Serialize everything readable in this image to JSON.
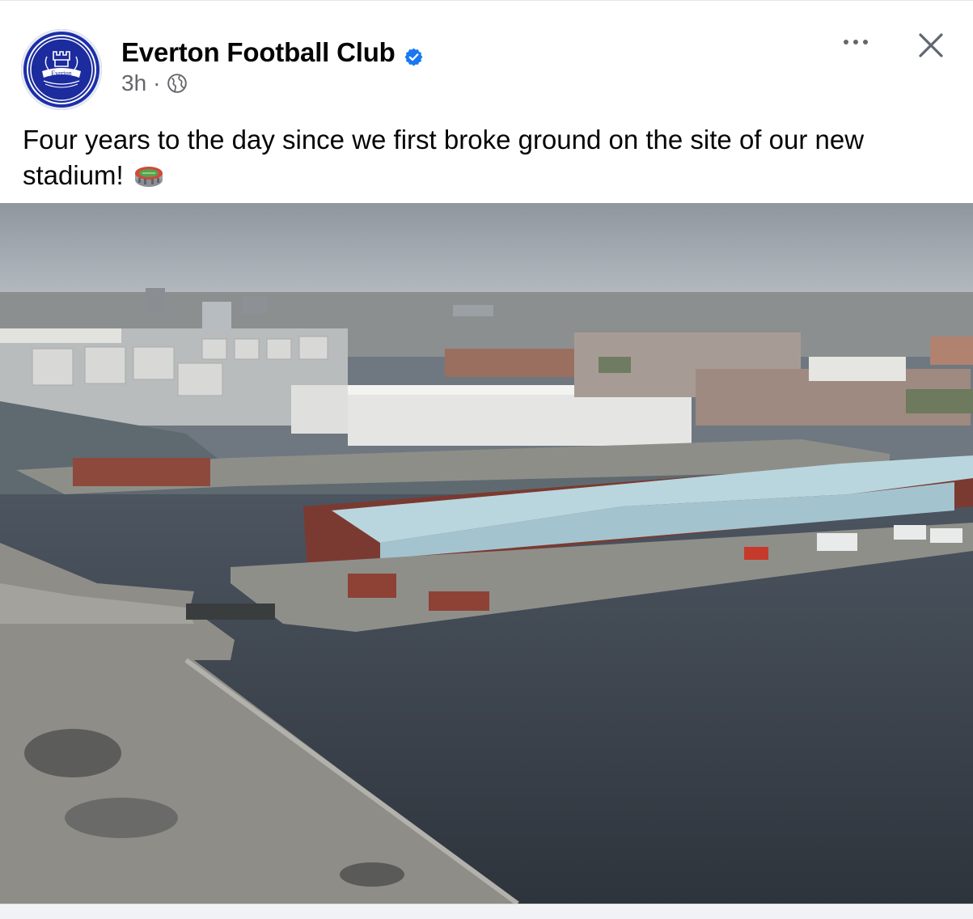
{
  "post": {
    "page_name": "Everton Football Club",
    "time": "3h",
    "separator": "·",
    "text": "Four years to the day since we first broke ground on the site of our new stadium!",
    "avatar_text": "Everton",
    "icons": {
      "verified": "verified-badge-icon",
      "privacy": "globe-icon",
      "more": "more-options-icon",
      "close": "close-icon",
      "emoji": "stadium-emoji-icon"
    },
    "colors": {
      "badge": "#1877f2",
      "crest": "#1c2c9e"
    }
  }
}
